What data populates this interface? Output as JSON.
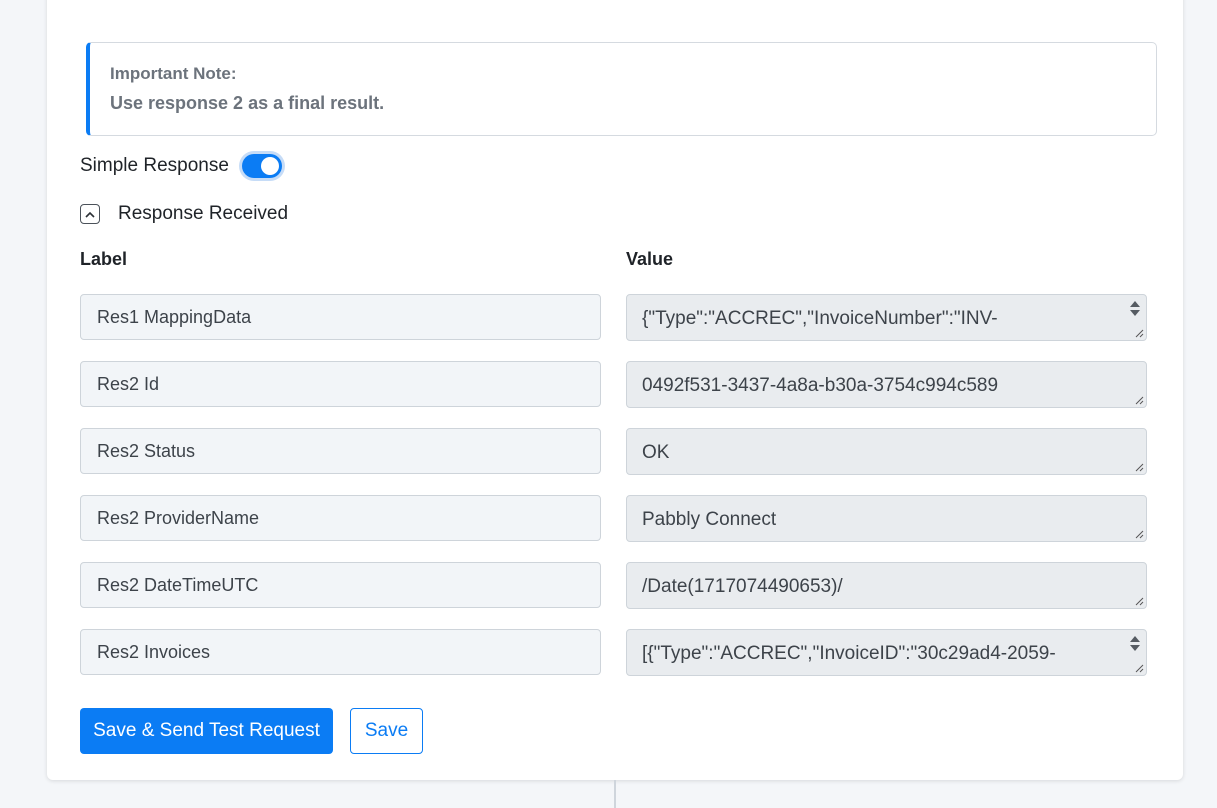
{
  "note": {
    "title": "Important Note:",
    "text": "Use response 2 as a final result."
  },
  "simple_response": {
    "label": "Simple Response",
    "enabled": true
  },
  "response_received": {
    "label": "Response Received",
    "expanded": true
  },
  "columns": {
    "label": "Label",
    "value": "Value"
  },
  "rows": [
    {
      "label": "Res1 MappingData",
      "value": "{\"Type\":\"ACCREC\",\"InvoiceNumber\":\"INV-",
      "scrollable": true
    },
    {
      "label": "Res2 Id",
      "value": "0492f531-3437-4a8a-b30a-3754c994c589",
      "scrollable": false
    },
    {
      "label": "Res2 Status",
      "value": "OK",
      "scrollable": false
    },
    {
      "label": "Res2 ProviderName",
      "value": "Pabbly Connect",
      "scrollable": false
    },
    {
      "label": "Res2 DateTimeUTC",
      "value": "/Date(1717074490653)/",
      "scrollable": false
    },
    {
      "label": "Res2 Invoices",
      "value": "[{\"Type\":\"ACCREC\",\"InvoiceID\":\"30c29ad4-2059-",
      "scrollable": true
    }
  ],
  "buttons": {
    "send_test": "Save & Send Test Request",
    "save": "Save"
  },
  "colors": {
    "accent": "#0b7cf4",
    "page_bg": "#f4f6f9",
    "label_bg": "#f2f5f8",
    "value_bg": "#e9ecef"
  }
}
